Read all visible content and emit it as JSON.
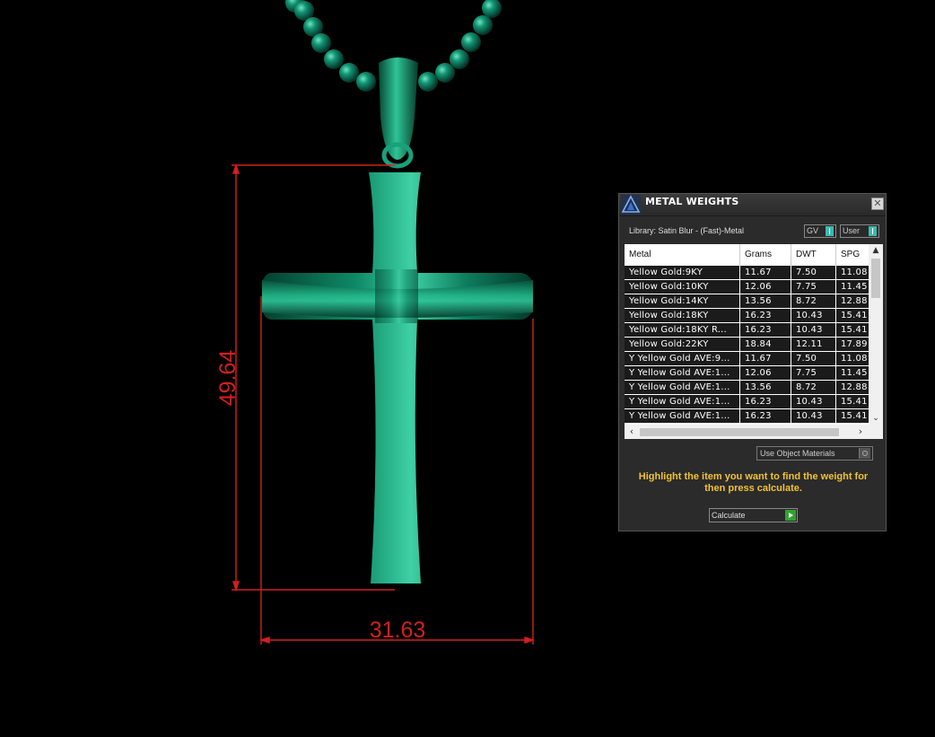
{
  "dimensions": {
    "height_label": "49.64",
    "width_label": "31.63",
    "line_color": "#d21f1f"
  },
  "model": {
    "color": "#0f8a68"
  },
  "panel": {
    "title": "METAL WEIGHTS",
    "close_glyph": "✕",
    "library": "Library: Satin Blur - (Fast)-Metal",
    "toggles": {
      "gv": "GV",
      "user": "User"
    },
    "columns": [
      "Metal",
      "Grams",
      "DWT",
      "SPG"
    ],
    "rows": [
      [
        "Yellow Gold:9KY",
        "11.67",
        "7.50",
        "11.08"
      ],
      [
        "Yellow Gold:10KY",
        "12.06",
        "7.75",
        "11.45"
      ],
      [
        "Yellow Gold:14KY",
        "13.56",
        "8.72",
        "12.88"
      ],
      [
        "Yellow Gold:18KY",
        "16.23",
        "10.43",
        "15.41"
      ],
      [
        "Yellow Gold:18KY R...",
        "16.23",
        "10.43",
        "15.41"
      ],
      [
        "Yellow Gold:22KY",
        "18.84",
        "12.11",
        "17.89"
      ],
      [
        "Y Yellow Gold AVE:9...",
        "11.67",
        "7.50",
        "11.08"
      ],
      [
        "Y Yellow Gold AVE:1...",
        "12.06",
        "7.75",
        "11.45"
      ],
      [
        "Y Yellow Gold AVE:1...",
        "13.56",
        "8.72",
        "12.88"
      ],
      [
        "Y Yellow Gold AVE:1...",
        "16.23",
        "10.43",
        "15.41"
      ],
      [
        "Y Yellow Gold AVE:1...",
        "16.23",
        "10.43",
        "15.41"
      ]
    ],
    "use_object_materials": "Use Object Materials",
    "instruction": "Highlight the item you want to find the weight for then press calculate.",
    "calculate_label": "Calculate",
    "accent_color": "#f2c230"
  }
}
